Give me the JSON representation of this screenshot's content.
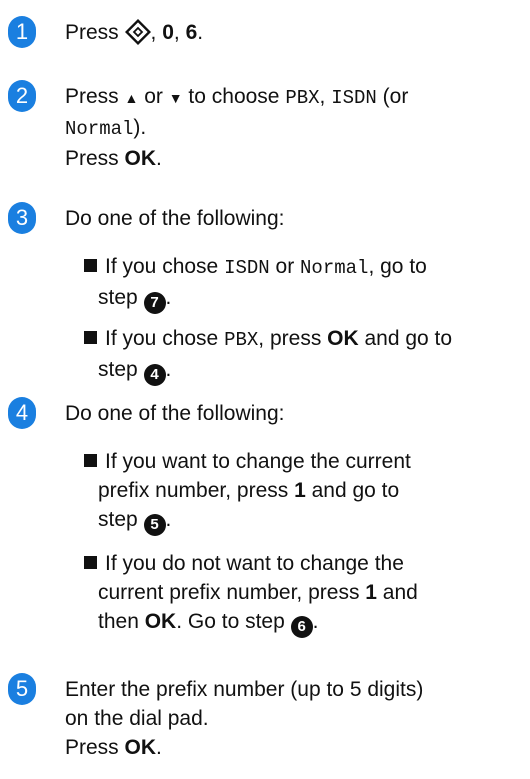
{
  "steps": [
    {
      "num": "1",
      "press": "Press",
      "key_a": "0",
      "key_b": "6"
    },
    {
      "num": "2",
      "l1_a": "Press ",
      "up": "▲",
      "or": " or ",
      "down": "▼",
      "l1_b": " to choose ",
      "opt1": "PBX",
      "comma1": ", ",
      "opt2": "ISDN",
      "l1_c": " (or",
      "opt3": "Normal",
      "l2_b": ").",
      "l3_a": "Press ",
      "ok": "OK",
      "l3_b": "."
    },
    {
      "num": "3",
      "intro": "Do one of the following:",
      "b1_a": "If you chose ",
      "b1_o1": "ISDN",
      "b1_or": " or ",
      "b1_o2": "Normal",
      "b1_b": ", go to",
      "b1_step": "step ",
      "b1_ref": "7",
      "b2_a": "If you chose ",
      "b2_o": "PBX",
      "b2_b": ", press ",
      "b2_ok": "OK",
      "b2_c": " and go to",
      "b2_step": "step ",
      "b2_ref": "4"
    },
    {
      "num": "4",
      "intro": "Do one of the following:",
      "b1_l1": "If you want to change the current",
      "b1_l2_a": "prefix number, press ",
      "b1_l2_k": "1",
      "b1_l2_b": " and go to",
      "b1_step": "step ",
      "b1_ref": "5",
      "b2_l1": "If you do not want to change the",
      "b2_l2_a": "current prefix number, press ",
      "b2_l2_k": "1",
      "b2_l2_b": " and",
      "b2_l3_a": "then ",
      "b2_l3_ok": "OK",
      "b2_l3_b": ". Go to step ",
      "b2_ref": "6"
    },
    {
      "num": "5",
      "l1": "Enter the prefix number (up to 5 digits)",
      "l2": "on the dial pad.",
      "l3_a": "Press ",
      "ok": "OK",
      "l3_b": "."
    }
  ]
}
